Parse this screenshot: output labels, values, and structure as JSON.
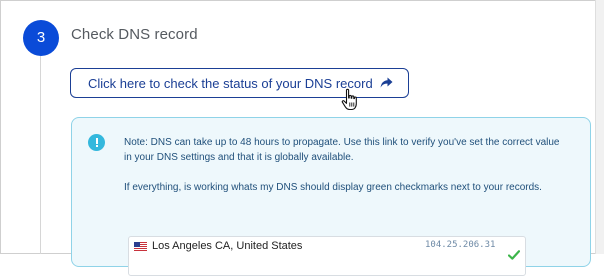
{
  "step": {
    "number": "3",
    "title": "Check DNS record"
  },
  "check_button": {
    "label": "Click here to check the status of your DNS record",
    "icon": "share-arrow-icon"
  },
  "note": {
    "icon": "info-icon",
    "paragraph_1": "Note: DNS can take up to 48 hours to propagate. Use this link to verify you've set the correct value in your DNS settings and that it is globally available.",
    "paragraph_2": "If everything, is working whats my DNS should display green checkmarks next to your records."
  },
  "result": {
    "location": "Los Angeles CA, United States",
    "ip": "104.25.206.31",
    "status_icon": "green-checkmark-icon"
  },
  "colors": {
    "step_circle": "#0a4bd8",
    "button_border": "#1b3f95",
    "note_background": "#eef8fc",
    "note_border": "#8fd3e8",
    "info_icon": "#34b8dd",
    "check_green": "#3cb54a"
  }
}
